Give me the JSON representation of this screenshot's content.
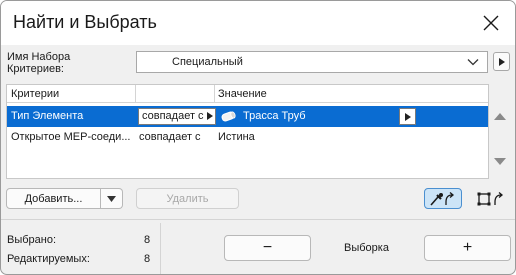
{
  "window": {
    "title": "Найти и Выбрать"
  },
  "criteria_set": {
    "label_line1": "Имя Набора",
    "label_line2": "Критериев:",
    "value": "Специальный"
  },
  "table": {
    "headers": [
      "Критерии",
      "",
      "Значение"
    ],
    "rows": [
      {
        "criterion": "Тип Элемента",
        "operator": "совпадает с",
        "value": "Трасса Труб",
        "selected": true
      },
      {
        "criterion": "Открытое MEP-соеди...",
        "operator": "совпадает с",
        "value": "Истина",
        "selected": false
      }
    ]
  },
  "buttons": {
    "add": "Добавить...",
    "delete": "Удалить",
    "minus": "−",
    "plus": "+"
  },
  "stats": {
    "selected_label": "Выбрано:",
    "selected_count": "8",
    "editable_label": "Редактируемых:",
    "editable_count": "8"
  },
  "selection_label": "Выборка",
  "icons": [
    "close-icon",
    "chevron-down-icon",
    "arrow-right-icon",
    "pipe-icon",
    "scroll-up-icon",
    "scroll-down-icon",
    "eyedropper-icon",
    "crop-icon"
  ],
  "colors": {
    "selection": "#0a6cd2",
    "pick_active": "#cce4f7"
  }
}
